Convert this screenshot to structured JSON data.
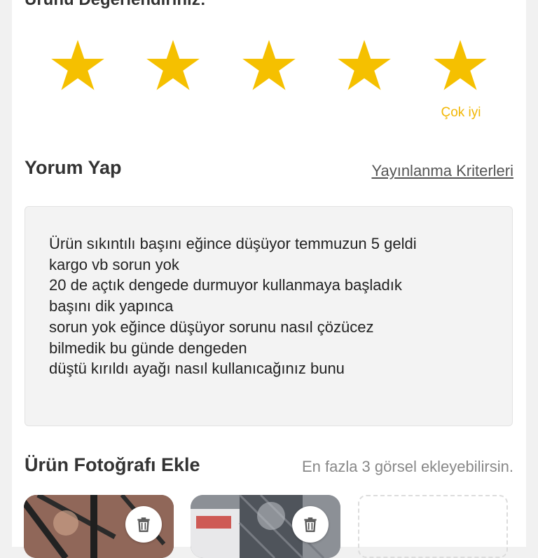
{
  "rating": {
    "title": "Ürünü Değerlendiriniz:",
    "value": 5,
    "max": 5,
    "label": "Çok iyi",
    "star_color": "#f5c000",
    "label_color": "#f2b705"
  },
  "comment": {
    "title": "Yorum Yap",
    "criteria_link": "Yayınlanma Kriterleri",
    "text": "Ürün sıkıntılı başını eğince düşüyor temmuzun 5 geldi\nkargo vb sorun yok\n20 de açtık dengede durmuyor kullanmaya başladık\nbaşını dik yapınca\nsorun yok eğince düşüyor sorunu nasıl çözücez\nbilmedik bu günde dengeden\ndüştü kırıldı ayağı nasıl kullanıcağınız bunu"
  },
  "photos": {
    "title": "Ürün Fotoğrafı Ekle",
    "hint": "En fazla 3 görsel ekleyebilirsin.",
    "items": [
      {
        "delete_icon": "trash-icon"
      },
      {
        "delete_icon": "trash-icon"
      }
    ],
    "add_slot_icon": "add-photo-slot"
  }
}
